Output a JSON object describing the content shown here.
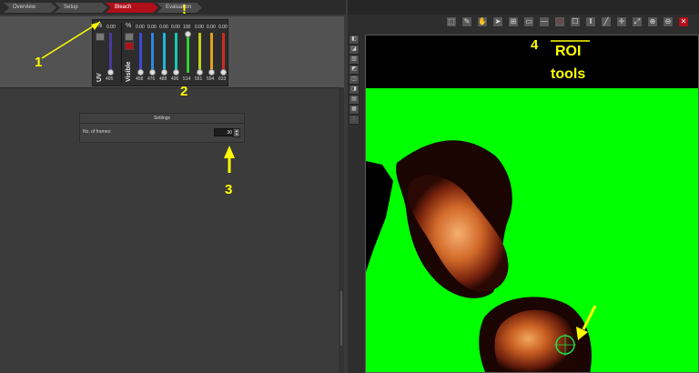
{
  "workflow_tabs": [
    {
      "label": "Overview",
      "active": false
    },
    {
      "label": "Setup",
      "active": false
    },
    {
      "label": "Bleach",
      "active": true
    },
    {
      "label": "Evaluation",
      "active": false
    }
  ],
  "laser_panel": {
    "uv_label": "UV",
    "visible_label": "Visible",
    "percent_symbol": "%",
    "uv_percent": "0.00",
    "uv_wavelength": "405",
    "visible_lines": [
      {
        "percent": "0.00",
        "wavelength": "458",
        "color": "#3b4bd6"
      },
      {
        "percent": "0.00",
        "wavelength": "476",
        "color": "#2f86e0"
      },
      {
        "percent": "0.00",
        "wavelength": "488",
        "color": "#1fb5d8"
      },
      {
        "percent": "0.00",
        "wavelength": "496",
        "color": "#16c8b0"
      },
      {
        "percent": "100",
        "wavelength": "514",
        "color": "#2fd12f"
      },
      {
        "percent": "0.00",
        "wavelength": "561",
        "color": "#bcd21e"
      },
      {
        "percent": "0.00",
        "wavelength": "594",
        "color": "#e0a21c"
      },
      {
        "percent": "0.00",
        "wavelength": "633",
        "color": "#d02a1e"
      }
    ],
    "uv_toggle": "On",
    "visible_toggle": "On"
  },
  "settings": {
    "title": "Settings",
    "frames_label": "No. of frames:",
    "frames_value": "30",
    "spin_up": "▲",
    "spin_down": "▼"
  },
  "annotations": {
    "n1": "1",
    "n2": "2",
    "n3": "3",
    "n4": "4",
    "exclaim": "!",
    "roi_line1": "ROI",
    "roi_line2": "tools"
  },
  "toolbar_icons": [
    "ruler-icon",
    "pencil-icon",
    "hand-icon",
    "pointer-icon",
    "zoom-region-icon",
    "rectangle-icon",
    "line-icon",
    "ellipse-icon",
    "freehand-icon",
    "bars-icon",
    "line-tool-icon",
    "crosshair-icon",
    "fit-icon",
    "zoom-in-icon",
    "zoom-out-icon",
    "close-icon"
  ],
  "toolbar_glyphs": [
    "⬚",
    "✎",
    "✋",
    "➤",
    "⊞",
    "▭",
    "—",
    "⬭",
    "☐",
    "‖",
    "╱",
    "✛",
    "⤢",
    "⊕",
    "⊖",
    "✕"
  ],
  "vtoolbar_glyphs": [
    "◧",
    "◪",
    "▥",
    "◩",
    "◫",
    "◨",
    "▤",
    "▦",
    "⫶"
  ],
  "colors": {
    "accent_red": "#b10f1a",
    "image_green": "#00ff00",
    "annotation_yellow": "#ffff00"
  }
}
